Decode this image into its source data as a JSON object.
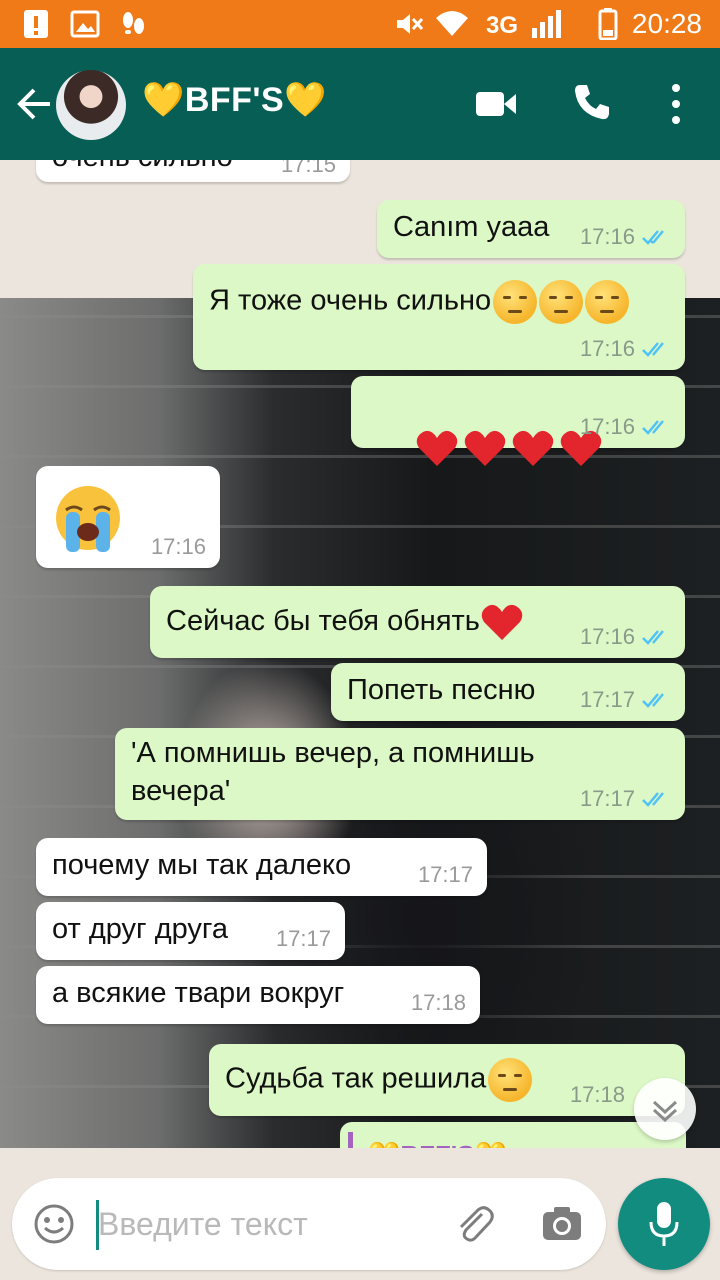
{
  "status_bar": {
    "time": "20:28",
    "network": "3G",
    "icons": [
      "alert-icon",
      "image-icon",
      "steps-icon",
      "mute-icon",
      "wifi-icon",
      "signal-icon",
      "battery-icon"
    ]
  },
  "header": {
    "title": "💛BFF'S💛",
    "icons": [
      "back-arrow-icon",
      "avatar",
      "video-call-icon",
      "phone-icon",
      "more-vert-icon"
    ]
  },
  "messages": [
    {
      "dir": "in",
      "text": "очень сильно",
      "time": "17:15"
    },
    {
      "dir": "out",
      "text": "Canım yaaa",
      "time": "17:16",
      "read": true
    },
    {
      "dir": "out",
      "text": "Я тоже очень сильно",
      "emoji": "pensive x3",
      "time": "17:16",
      "read": true
    },
    {
      "dir": "out",
      "text": "",
      "emoji": "red-heart x4",
      "time": "17:16",
      "read": true
    },
    {
      "dir": "in",
      "text": "",
      "emoji": "loudly-crying",
      "time": "17:16"
    },
    {
      "dir": "out",
      "text": "Сейчас бы тебя обнять",
      "emoji": "red-heart",
      "time": "17:16",
      "read": true
    },
    {
      "dir": "out",
      "text": "Попеть песню",
      "time": "17:17",
      "read": true
    },
    {
      "dir": "out",
      "text": "'А помнишь вечер, а помнишь\nвечера'",
      "time": "17:17",
      "read": true
    },
    {
      "dir": "in",
      "text": "почему мы так далеко",
      "time": "17:17"
    },
    {
      "dir": "in",
      "text": "от друг друга",
      "time": "17:17"
    },
    {
      "dir": "in",
      "text": "а всякие твари вокруг",
      "time": "17:18"
    },
    {
      "dir": "out",
      "text": "Судьба так решила",
      "emoji": "pensive",
      "time": "17:18",
      "read": true
    }
  ],
  "quote_preview": {
    "name": "💛BFF'S💛"
  },
  "input": {
    "placeholder": "Введите текст",
    "icons": [
      "emoji-icon",
      "attach-icon",
      "camera-icon",
      "mic-icon"
    ]
  },
  "colors": {
    "status_bar": "#f07a17",
    "app_bar": "#075e54",
    "outgoing_bubble": "#dcf8c6",
    "incoming_bubble": "#ffffff",
    "read_ticks": "#4fc3f7",
    "mic_button": "#128c7e"
  }
}
